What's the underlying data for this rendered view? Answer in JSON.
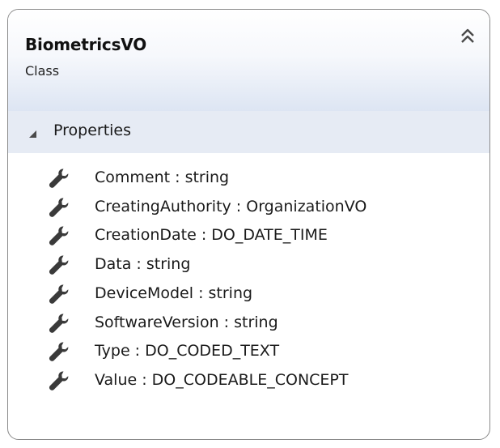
{
  "class": {
    "name": "BiometricsVO",
    "stereotype": "Class",
    "collapse_icon": "double-chevron-up-icon"
  },
  "properties_section": {
    "label": "Properties",
    "toggle_icon": "triangle-expanded-icon",
    "member_icon": "wrench-icon",
    "items": [
      "Comment : string",
      "CreatingAuthority : OrganizationVO",
      "CreationDate : DO_DATE_TIME",
      "Data : string",
      "DeviceModel : string",
      "SoftwareVersion : string",
      "Type : DO_CODED_TEXT",
      "Value : DO_CODEABLE_CONCEPT"
    ]
  },
  "colors": {
    "border": "#8a8a8a",
    "header_gradient_bottom": "#dde5f3",
    "section_header_bg": "#e6ebf4",
    "icon": "#3a3a3a"
  }
}
